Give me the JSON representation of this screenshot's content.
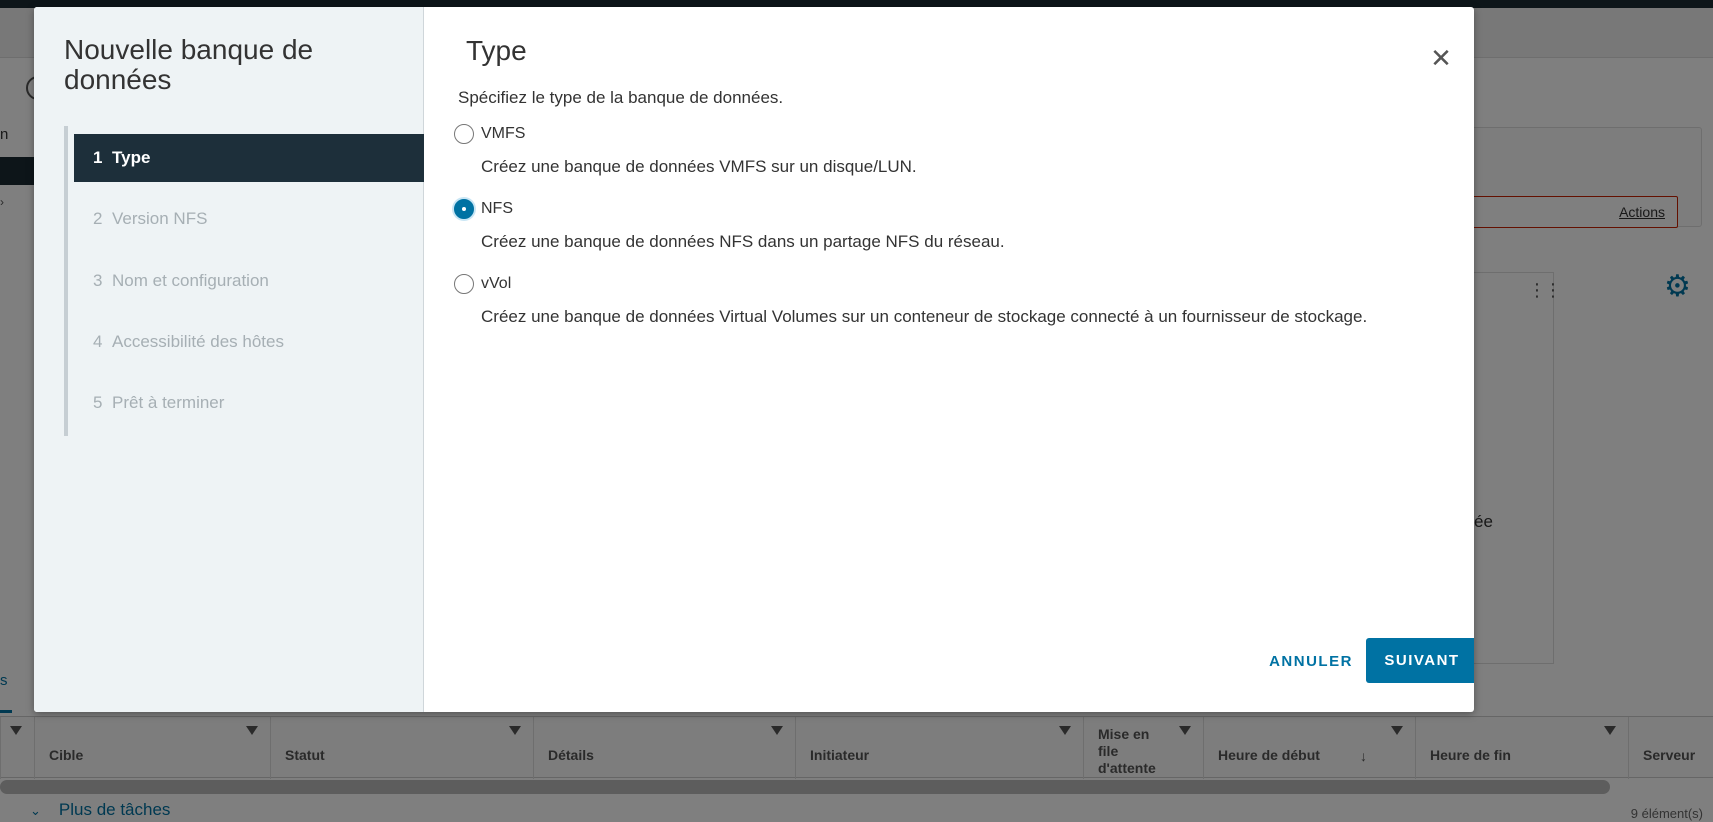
{
  "background": {
    "left_text": "n",
    "actions_label": "Actions",
    "right_snippet": "ée",
    "taskbar_tab": "s",
    "table_columns": [
      {
        "label": "Cible"
      },
      {
        "label": "Statut"
      },
      {
        "label": "Détails"
      },
      {
        "label": "Initiateur"
      },
      {
        "label": "Mise en file d'attente"
      },
      {
        "label": "Heure de début"
      },
      {
        "label": "Heure de fin"
      },
      {
        "label": "Serveur"
      }
    ],
    "more_tasks": "Plus de tâches",
    "item_count": "9 élément(s)"
  },
  "wizard": {
    "title": "Nouvelle banque de données",
    "steps": [
      {
        "num": "1",
        "label": "Type",
        "active": true
      },
      {
        "num": "2",
        "label": "Version NFS",
        "active": false
      },
      {
        "num": "3",
        "label": "Nom et configuration",
        "active": false
      },
      {
        "num": "4",
        "label": "Accessibilité des hôtes",
        "active": false
      },
      {
        "num": "5",
        "label": "Prêt à terminer",
        "active": false
      }
    ],
    "content": {
      "title": "Type",
      "description": "Spécifiez le type de la banque de données.",
      "options": [
        {
          "label": "VMFS",
          "description": "Créez une banque de données VMFS sur un disque/LUN.",
          "checked": false
        },
        {
          "label": "NFS",
          "description": "Créez une banque de données NFS dans un partage NFS du réseau.",
          "checked": true
        },
        {
          "label": "vVol",
          "description": "Créez une banque de données Virtual Volumes sur un conteneur de stockage connecté à un fournisseur de stockage.",
          "checked": false
        }
      ]
    },
    "buttons": {
      "cancel": "ANNULER",
      "next": "SUIVANT"
    },
    "close_icon": "close-icon",
    "accent_color": "#0072a3"
  }
}
